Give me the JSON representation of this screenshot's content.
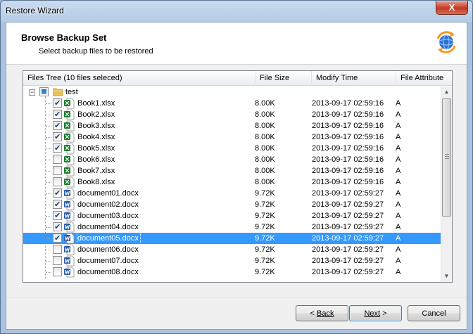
{
  "window": {
    "title": "Restore Wizard",
    "close_glyph": "X"
  },
  "header": {
    "title": "Browse Backup Set",
    "subtitle": "Select backup files to be restored",
    "icon": "sync-globe-icon"
  },
  "list": {
    "columns": [
      "Files Tree (10 files seleced)",
      "File Size",
      "Modify Time",
      "File Attribute"
    ],
    "root": {
      "name": "test",
      "checkbox_state": "partial",
      "expanded": true
    },
    "files": [
      {
        "name": "Book1.xlsx",
        "size": "8.00K",
        "modified": "2013-09-17 02:59:16",
        "attr": "A",
        "checked": true,
        "type": "excel"
      },
      {
        "name": "Book2.xlsx",
        "size": "8.00K",
        "modified": "2013-09-17 02:59:16",
        "attr": "A",
        "checked": true,
        "type": "excel"
      },
      {
        "name": "Book3.xlsx",
        "size": "8.00K",
        "modified": "2013-09-17 02:59:16",
        "attr": "A",
        "checked": true,
        "type": "excel"
      },
      {
        "name": "Book4.xlsx",
        "size": "8.00K",
        "modified": "2013-09-17 02:59:16",
        "attr": "A",
        "checked": true,
        "type": "excel"
      },
      {
        "name": "Book5.xlsx",
        "size": "8.00K",
        "modified": "2013-09-17 02:59:16",
        "attr": "A",
        "checked": true,
        "type": "excel"
      },
      {
        "name": "Book6.xlsx",
        "size": "8.00K",
        "modified": "2013-09-17 02:59:16",
        "attr": "A",
        "checked": false,
        "type": "excel"
      },
      {
        "name": "Book7.xlsx",
        "size": "8.00K",
        "modified": "2013-09-17 02:59:16",
        "attr": "A",
        "checked": false,
        "type": "excel"
      },
      {
        "name": "Book8.xlsx",
        "size": "8.00K",
        "modified": "2013-09-17 02:59:16",
        "attr": "A",
        "checked": false,
        "type": "excel"
      },
      {
        "name": "document01.docx",
        "size": "9.72K",
        "modified": "2013-09-17 02:59:27",
        "attr": "A",
        "checked": true,
        "type": "word"
      },
      {
        "name": "document02.docx",
        "size": "9.72K",
        "modified": "2013-09-17 02:59:27",
        "attr": "A",
        "checked": true,
        "type": "word"
      },
      {
        "name": "document03.docx",
        "size": "9.72K",
        "modified": "2013-09-17 02:59:27",
        "attr": "A",
        "checked": true,
        "type": "word"
      },
      {
        "name": "document04.docx",
        "size": "9.72K",
        "modified": "2013-09-17 02:59:27",
        "attr": "A",
        "checked": true,
        "type": "word"
      },
      {
        "name": "document05.docx",
        "size": "9.72K",
        "modified": "2013-09-17 02:59:27",
        "attr": "A",
        "checked": true,
        "type": "word",
        "selected": true
      },
      {
        "name": "document06.docx",
        "size": "9.72K",
        "modified": "2013-09-17 02:59:27",
        "attr": "A",
        "checked": false,
        "type": "word"
      },
      {
        "name": "document07.docx",
        "size": "9.72K",
        "modified": "2013-09-17 02:59:27",
        "attr": "A",
        "checked": false,
        "type": "word"
      },
      {
        "name": "document08.docx",
        "size": "9.72K",
        "modified": "2013-09-17 02:59:27",
        "attr": "A",
        "checked": false,
        "type": "word"
      }
    ]
  },
  "buttons": {
    "back": {
      "arrow": "<",
      "label": "Back"
    },
    "next": {
      "arrow": ">",
      "label": "Next"
    },
    "cancel": {
      "label": "Cancel"
    }
  },
  "colors": {
    "selection": "#3399ff",
    "excel": "#1f7a2f",
    "word": "#2a5cab"
  }
}
